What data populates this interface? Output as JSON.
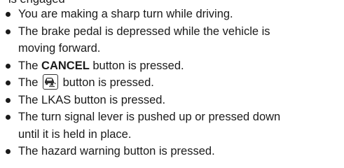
{
  "doc": {
    "clipped_top_text": "is engaged",
    "bullets": [
      {
        "lines": [
          "You are making a sharp turn while driving."
        ]
      },
      {
        "lines": [
          "The brake pedal is depressed while the vehicle is",
          "moving forward."
        ]
      },
      {
        "prefix": "The ",
        "emphasis": "CANCEL",
        "suffix": " button is pressed."
      },
      {
        "prefix": "The ",
        "icon": "distance-button-icon",
        "suffix": " button is pressed."
      },
      {
        "lines": [
          "The LKAS button is pressed."
        ]
      },
      {
        "lines": [
          "The turn signal lever is pushed up or pressed down",
          "until it is held in place."
        ]
      },
      {
        "lines": [
          "The hazard warning button is pressed."
        ]
      }
    ]
  }
}
